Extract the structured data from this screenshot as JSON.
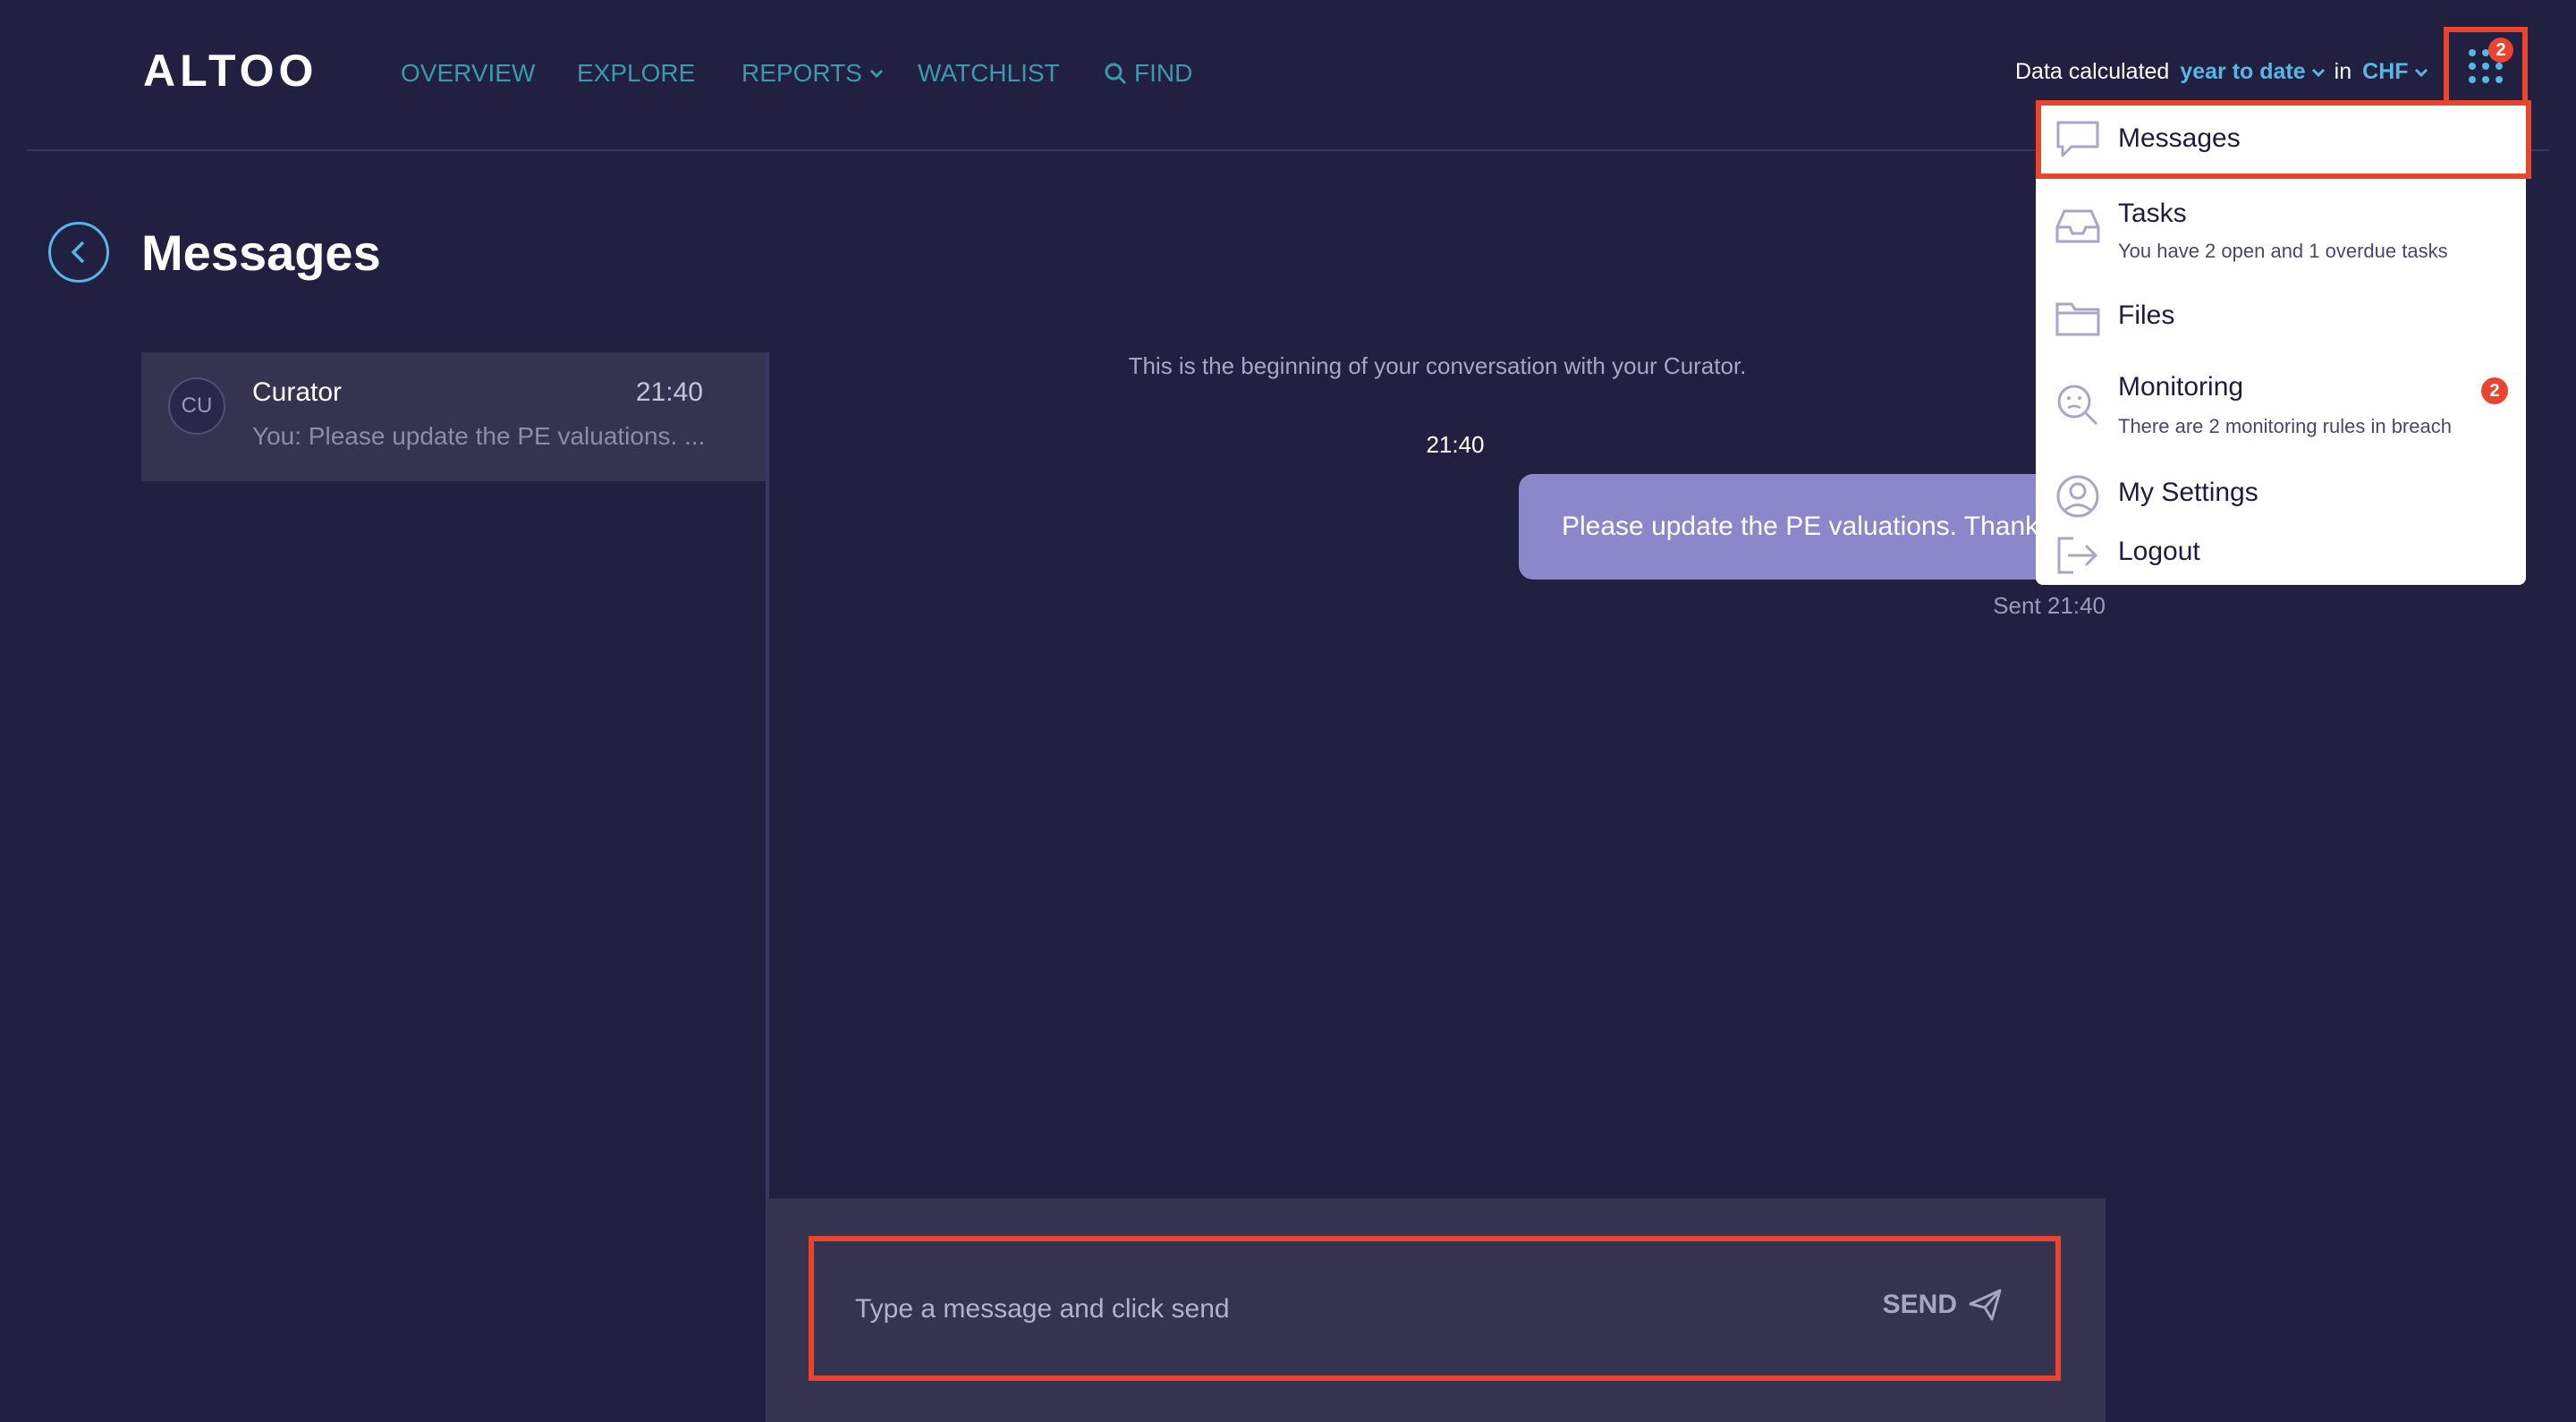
{
  "header": {
    "logo": "ALTOO",
    "nav": {
      "overview": "OVERVIEW",
      "explore": "EXPLORE",
      "reports": "REPORTS",
      "watchlist": "WATCHLIST",
      "find": "FIND"
    },
    "data_calc": {
      "prefix": "Data calculated",
      "period": "year to date",
      "in": "in",
      "currency": "CHF"
    },
    "apps_badge": "2"
  },
  "page": {
    "title": "Messages"
  },
  "conversations": [
    {
      "initials": "CU",
      "name": "Curator",
      "time": "21:40",
      "preview": "You: Please update the PE valuations. ..."
    }
  ],
  "chat": {
    "beginning": "This is the beginning of your conversation with your Curator.",
    "time": "21:40",
    "message": "Please update the PE valuations. Thank you",
    "sent": "Sent 21:40"
  },
  "composer": {
    "placeholder": "Type a message and click send",
    "send": "SEND"
  },
  "menu": {
    "messages": "Messages",
    "tasks": "Tasks",
    "tasks_sub": "You have 2 open and 1 overdue tasks",
    "files": "Files",
    "monitoring": "Monitoring",
    "monitoring_sub": "There are 2 monitoring rules in breach",
    "monitoring_badge": "2",
    "settings": "My Settings",
    "logout": "Logout"
  },
  "colors": {
    "background": "#222040",
    "accent": "#56b7e5",
    "nav": "#3c99ad",
    "highlight": "#e8442e",
    "bubble": "#8a88ca"
  }
}
